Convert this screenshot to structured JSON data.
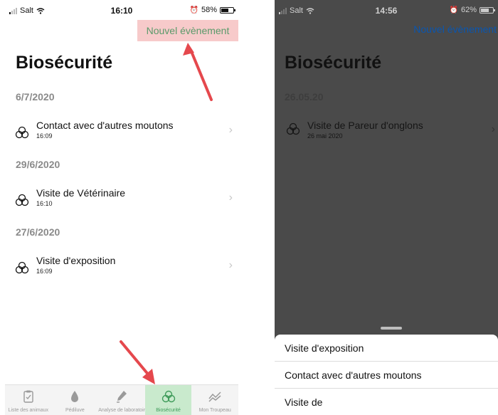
{
  "left_phone": {
    "status": {
      "carrier": "Salt",
      "time": "16:10",
      "battery": "58%",
      "battery_level": 0.58
    },
    "new_event_button": "Nouvel évènement",
    "title": "Biosécurité",
    "groups": [
      {
        "date": "6/7/2020",
        "entries": [
          {
            "title": "Contact avec d'autres moutons",
            "time": "16:09"
          }
        ]
      },
      {
        "date": "29/6/2020",
        "entries": [
          {
            "title": "Visite de Vétérinaire",
            "time": "16:10"
          }
        ]
      },
      {
        "date": "27/6/2020",
        "entries": [
          {
            "title": "Visite d'exposition",
            "time": "16:09"
          }
        ]
      }
    ],
    "tabs": [
      {
        "label": "Liste des animaux",
        "icon": "clipboard-icon",
        "active": false
      },
      {
        "label": "Pédiluve",
        "icon": "drop-icon",
        "active": false
      },
      {
        "label": "Analyse de laboratoire",
        "icon": "lab-icon",
        "active": false
      },
      {
        "label": "Biosécurité",
        "icon": "biohazard-icon",
        "active": true
      },
      {
        "label": "Mon Troupeau",
        "icon": "chart-icon",
        "active": false
      }
    ],
    "colors": {
      "highlight_button": "#f7caca",
      "green_text": "#5a9a6a",
      "active_tab": "#c9eacd",
      "arrow": "#e5484d"
    }
  },
  "right_phone": {
    "status": {
      "carrier": "Salt",
      "time": "14:56",
      "battery": "62%",
      "battery_level": 0.62
    },
    "new_event_button": "Nouvel évènement",
    "title": "Biosécurité",
    "group": {
      "date": "26.05.20",
      "entry": {
        "title": "Visite de Pareur d'onglons",
        "time": "26 mai 2020"
      }
    },
    "sheet_items": [
      "Visite d'exposition",
      "Contact avec d'autres moutons",
      "Visite de"
    ]
  }
}
